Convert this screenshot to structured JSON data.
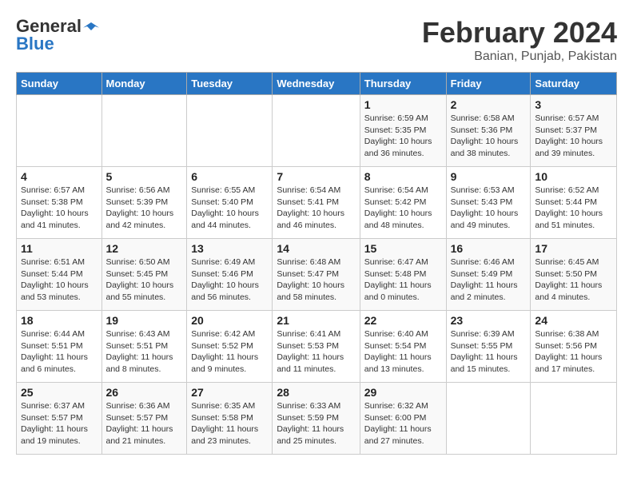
{
  "header": {
    "logo_general": "General",
    "logo_blue": "Blue",
    "month_title": "February 2024",
    "location": "Banian, Punjab, Pakistan"
  },
  "weekdays": [
    "Sunday",
    "Monday",
    "Tuesday",
    "Wednesday",
    "Thursday",
    "Friday",
    "Saturday"
  ],
  "weeks": [
    [
      {
        "day": "",
        "info": ""
      },
      {
        "day": "",
        "info": ""
      },
      {
        "day": "",
        "info": ""
      },
      {
        "day": "",
        "info": ""
      },
      {
        "day": "1",
        "info": "Sunrise: 6:59 AM\nSunset: 5:35 PM\nDaylight: 10 hours\nand 36 minutes."
      },
      {
        "day": "2",
        "info": "Sunrise: 6:58 AM\nSunset: 5:36 PM\nDaylight: 10 hours\nand 38 minutes."
      },
      {
        "day": "3",
        "info": "Sunrise: 6:57 AM\nSunset: 5:37 PM\nDaylight: 10 hours\nand 39 minutes."
      }
    ],
    [
      {
        "day": "4",
        "info": "Sunrise: 6:57 AM\nSunset: 5:38 PM\nDaylight: 10 hours\nand 41 minutes."
      },
      {
        "day": "5",
        "info": "Sunrise: 6:56 AM\nSunset: 5:39 PM\nDaylight: 10 hours\nand 42 minutes."
      },
      {
        "day": "6",
        "info": "Sunrise: 6:55 AM\nSunset: 5:40 PM\nDaylight: 10 hours\nand 44 minutes."
      },
      {
        "day": "7",
        "info": "Sunrise: 6:54 AM\nSunset: 5:41 PM\nDaylight: 10 hours\nand 46 minutes."
      },
      {
        "day": "8",
        "info": "Sunrise: 6:54 AM\nSunset: 5:42 PM\nDaylight: 10 hours\nand 48 minutes."
      },
      {
        "day": "9",
        "info": "Sunrise: 6:53 AM\nSunset: 5:43 PM\nDaylight: 10 hours\nand 49 minutes."
      },
      {
        "day": "10",
        "info": "Sunrise: 6:52 AM\nSunset: 5:44 PM\nDaylight: 10 hours\nand 51 minutes."
      }
    ],
    [
      {
        "day": "11",
        "info": "Sunrise: 6:51 AM\nSunset: 5:44 PM\nDaylight: 10 hours\nand 53 minutes."
      },
      {
        "day": "12",
        "info": "Sunrise: 6:50 AM\nSunset: 5:45 PM\nDaylight: 10 hours\nand 55 minutes."
      },
      {
        "day": "13",
        "info": "Sunrise: 6:49 AM\nSunset: 5:46 PM\nDaylight: 10 hours\nand 56 minutes."
      },
      {
        "day": "14",
        "info": "Sunrise: 6:48 AM\nSunset: 5:47 PM\nDaylight: 10 hours\nand 58 minutes."
      },
      {
        "day": "15",
        "info": "Sunrise: 6:47 AM\nSunset: 5:48 PM\nDaylight: 11 hours\nand 0 minutes."
      },
      {
        "day": "16",
        "info": "Sunrise: 6:46 AM\nSunset: 5:49 PM\nDaylight: 11 hours\nand 2 minutes."
      },
      {
        "day": "17",
        "info": "Sunrise: 6:45 AM\nSunset: 5:50 PM\nDaylight: 11 hours\nand 4 minutes."
      }
    ],
    [
      {
        "day": "18",
        "info": "Sunrise: 6:44 AM\nSunset: 5:51 PM\nDaylight: 11 hours\nand 6 minutes."
      },
      {
        "day": "19",
        "info": "Sunrise: 6:43 AM\nSunset: 5:51 PM\nDaylight: 11 hours\nand 8 minutes."
      },
      {
        "day": "20",
        "info": "Sunrise: 6:42 AM\nSunset: 5:52 PM\nDaylight: 11 hours\nand 9 minutes."
      },
      {
        "day": "21",
        "info": "Sunrise: 6:41 AM\nSunset: 5:53 PM\nDaylight: 11 hours\nand 11 minutes."
      },
      {
        "day": "22",
        "info": "Sunrise: 6:40 AM\nSunset: 5:54 PM\nDaylight: 11 hours\nand 13 minutes."
      },
      {
        "day": "23",
        "info": "Sunrise: 6:39 AM\nSunset: 5:55 PM\nDaylight: 11 hours\nand 15 minutes."
      },
      {
        "day": "24",
        "info": "Sunrise: 6:38 AM\nSunset: 5:56 PM\nDaylight: 11 hours\nand 17 minutes."
      }
    ],
    [
      {
        "day": "25",
        "info": "Sunrise: 6:37 AM\nSunset: 5:57 PM\nDaylight: 11 hours\nand 19 minutes."
      },
      {
        "day": "26",
        "info": "Sunrise: 6:36 AM\nSunset: 5:57 PM\nDaylight: 11 hours\nand 21 minutes."
      },
      {
        "day": "27",
        "info": "Sunrise: 6:35 AM\nSunset: 5:58 PM\nDaylight: 11 hours\nand 23 minutes."
      },
      {
        "day": "28",
        "info": "Sunrise: 6:33 AM\nSunset: 5:59 PM\nDaylight: 11 hours\nand 25 minutes."
      },
      {
        "day": "29",
        "info": "Sunrise: 6:32 AM\nSunset: 6:00 PM\nDaylight: 11 hours\nand 27 minutes."
      },
      {
        "day": "",
        "info": ""
      },
      {
        "day": "",
        "info": ""
      }
    ]
  ]
}
